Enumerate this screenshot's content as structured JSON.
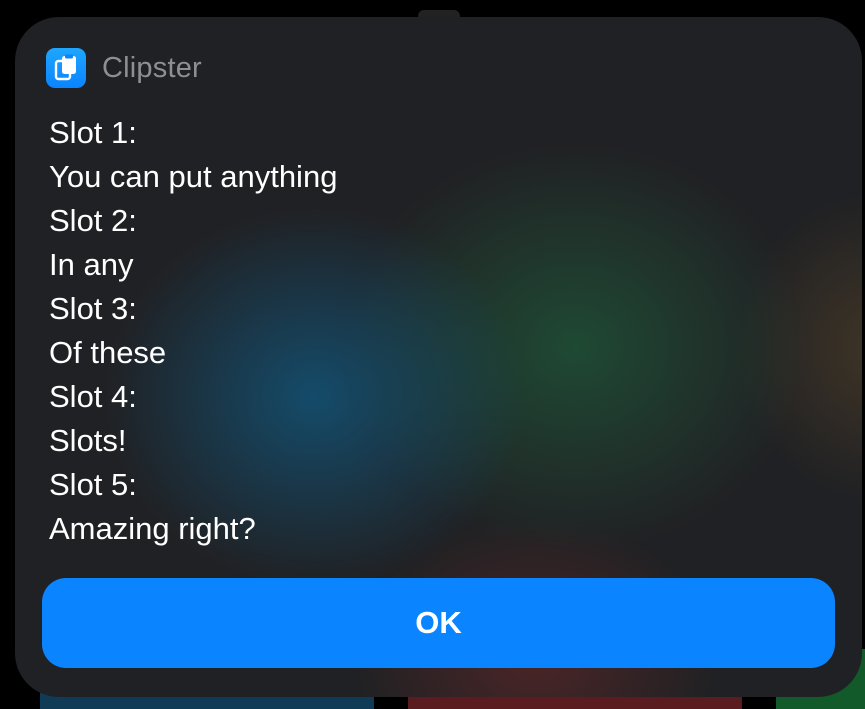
{
  "app": {
    "name": "Clipster",
    "icon": "clipboard-icon",
    "accent_color": "#0a84ff"
  },
  "message_lines": [
    "Slot 1:",
    "You can put anything",
    "Slot 2:",
    "In any",
    "Slot 3:",
    "Of these",
    "Slot 4:",
    "Slots!",
    "Slot 5:",
    "Amazing right?"
  ],
  "buttons": {
    "ok_label": "OK"
  }
}
